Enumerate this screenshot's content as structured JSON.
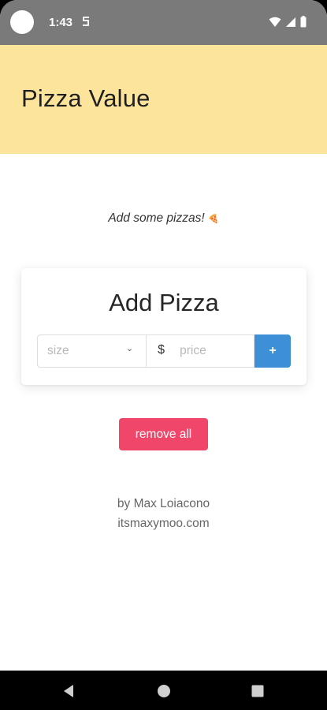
{
  "status_bar": {
    "time": "1:43",
    "background_color": "#7a7a7a",
    "icons": [
      "camera-cutout",
      "notification-icon",
      "wifi-icon",
      "cellular-signal-icon",
      "battery-icon"
    ]
  },
  "header": {
    "title": "Pizza Value",
    "background_color": "#fde49b"
  },
  "empty_state": {
    "message": "Add some pizzas!",
    "emoji": "🍕"
  },
  "add_pizza_card": {
    "title": "Add Pizza",
    "size_field": {
      "placeholder": "size",
      "dropdown_glyph": "⌄"
    },
    "price_field": {
      "currency_symbol": "$",
      "placeholder": "price"
    },
    "add_button": {
      "label": "+",
      "color": "#3d8fd6"
    }
  },
  "remove_all_button": {
    "label": "remove all",
    "color": "#ef466a"
  },
  "footer": {
    "author": "by Max Loiacono",
    "website": "itsmaxymoo.com"
  },
  "nav_bar": {
    "icons": [
      "back-icon",
      "home-icon",
      "recents-icon"
    ]
  }
}
